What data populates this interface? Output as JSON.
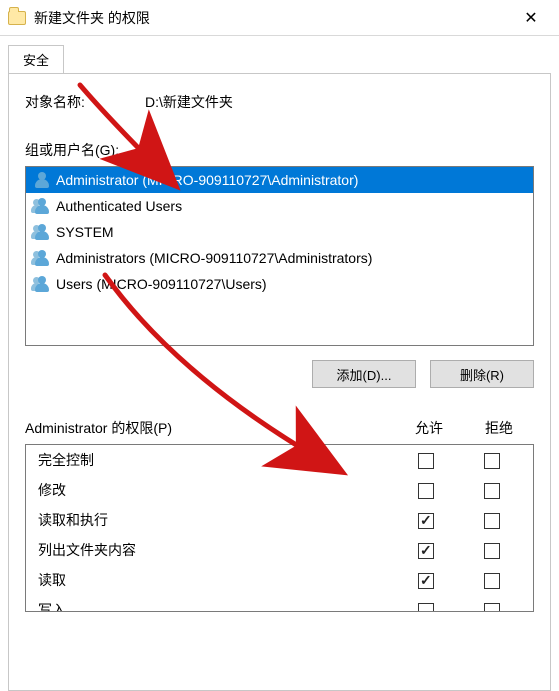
{
  "window": {
    "title": "新建文件夹 的权限"
  },
  "tab": {
    "label": "安全"
  },
  "object": {
    "label": "对象名称:",
    "value": "D:\\新建文件夹"
  },
  "groupsLabel": "组或用户名(G):",
  "users": [
    {
      "label": "Administrator (MICRO-909110727\\Administrator)",
      "group": false,
      "selected": true
    },
    {
      "label": "Authenticated Users",
      "group": true,
      "selected": false
    },
    {
      "label": "SYSTEM",
      "group": true,
      "selected": false
    },
    {
      "label": "Administrators (MICRO-909110727\\Administrators)",
      "group": true,
      "selected": false
    },
    {
      "label": "Users (MICRO-909110727\\Users)",
      "group": true,
      "selected": false
    }
  ],
  "buttons": {
    "add": "添加(D)...",
    "remove": "删除(R)"
  },
  "permHeader": {
    "title": "Administrator 的权限(P)",
    "allow": "允许",
    "deny": "拒绝"
  },
  "permissions": [
    {
      "name": "完全控制",
      "allow": false,
      "deny": false
    },
    {
      "name": "修改",
      "allow": false,
      "deny": false
    },
    {
      "name": "读取和执行",
      "allow": true,
      "deny": false
    },
    {
      "name": "列出文件夹内容",
      "allow": true,
      "deny": false
    },
    {
      "name": "读取",
      "allow": true,
      "deny": false
    },
    {
      "name": "写入",
      "allow": false,
      "deny": false
    }
  ],
  "annotation": {
    "color": "#d01515"
  }
}
